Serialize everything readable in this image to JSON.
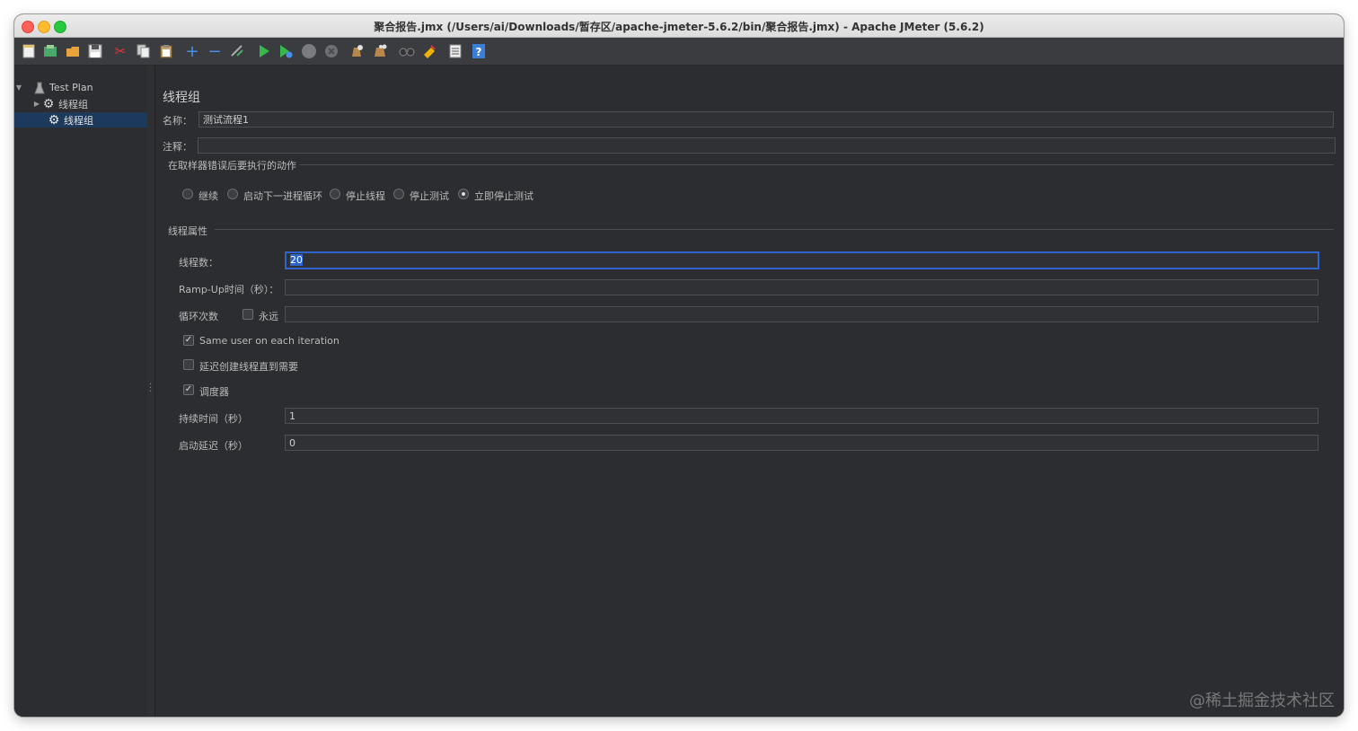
{
  "window": {
    "title": "聚合报告.jmx (/Users/ai/Downloads/暂存区/apache-jmeter-5.6.2/bin/聚合报告.jmx) - Apache JMeter (5.6.2)"
  },
  "toolbar": {
    "icons": [
      "new-icon",
      "templates-icon",
      "open-icon",
      "save-icon",
      "cut-icon",
      "copy-icon",
      "paste-icon",
      "expand-icon",
      "collapse-icon",
      "toggle-icon",
      "start-icon",
      "start-no-pause-icon",
      "stop-icon",
      "shutdown-icon",
      "clear-icon",
      "clear-all-icon",
      "search-icon",
      "reset-search-icon",
      "function-helper-icon",
      "help-icon"
    ]
  },
  "tree": {
    "items": [
      {
        "label": "Test Plan",
        "icon": "test-plan-icon"
      },
      {
        "label": "线程组",
        "icon": "gear-icon"
      },
      {
        "label": "线程组",
        "icon": "gear-icon"
      }
    ]
  },
  "panel": {
    "heading": "线程组",
    "name_label": "名称：",
    "name_value": "测试流程1",
    "comment_label": "注释：",
    "comment_value": "",
    "on_error": {
      "title": "在取样器错误后要执行的动作",
      "options": [
        "继续",
        "启动下一进程循环",
        "停止线程",
        "停止测试",
        "立即停止测试"
      ],
      "selected": "立即停止测试"
    },
    "thread_props": {
      "title": "线程属性",
      "threads_label": "线程数：",
      "threads_value": "20",
      "rampup_label": "Ramp-Up时间（秒）：",
      "rampup_value": "",
      "loop_label": "循环次数",
      "forever_label": "永远",
      "forever_checked": false,
      "loop_value": "",
      "same_user_label": "Same user on each iteration",
      "same_user_checked": true,
      "delay_create_label": "延迟创建线程直到需要",
      "delay_create_checked": false,
      "scheduler_label": "调度器",
      "scheduler_checked": true,
      "duration_label": "持续时间（秒）",
      "duration_value": "1",
      "startup_delay_label": "启动延迟（秒）",
      "startup_delay_value": "0"
    }
  },
  "watermark": "@稀土掘金技术社区"
}
